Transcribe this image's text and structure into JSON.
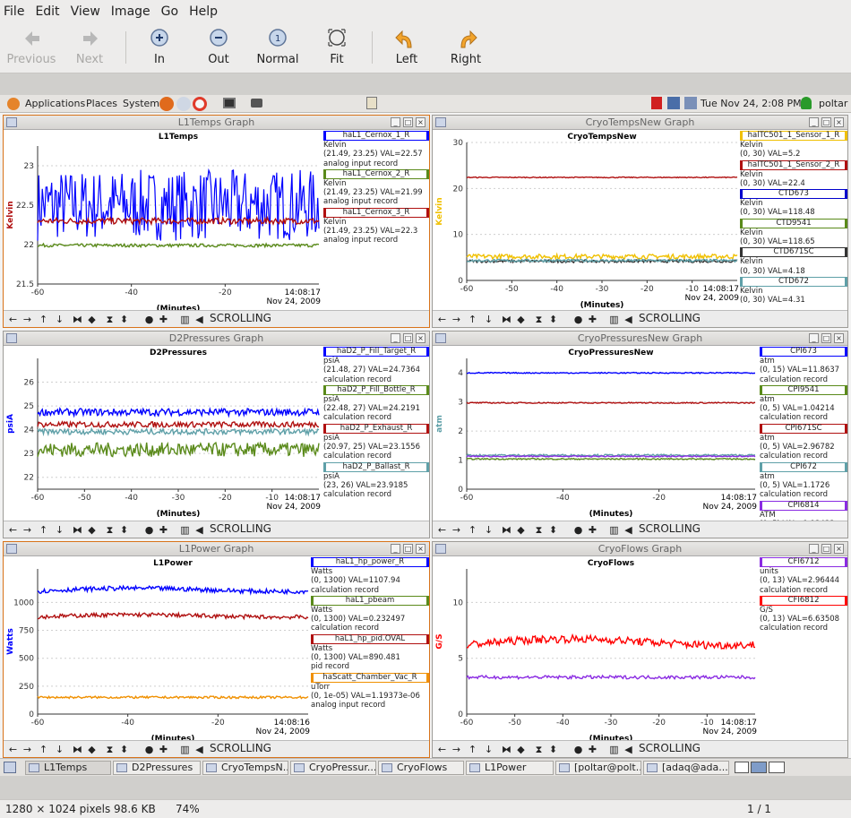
{
  "menubar": {
    "file": "File",
    "edit": "Edit",
    "view": "View",
    "image": "Image",
    "go": "Go",
    "help": "Help"
  },
  "toolbar": {
    "previous": "Previous",
    "next": "Next",
    "zoom_in": "In",
    "zoom_out": "Out",
    "normal": "Normal",
    "fit": "Fit",
    "rotate_left": "Left",
    "rotate_right": "Right"
  },
  "panel": {
    "applications": "Applications",
    "places": "Places",
    "system": "System",
    "clock": "Tue Nov 24,  2:08 PM",
    "user": "poltar"
  },
  "graphs": {
    "g1": {
      "window_title": "L1Temps Graph",
      "plot_title": "L1Temps",
      "ylabel": "Kelvin",
      "xlabel": "(Minutes)",
      "time": "14:08:17",
      "date": "Nov 24, 2009",
      "yticks": [
        "23",
        "22.5",
        "22",
        "21.5"
      ],
      "xticks": [
        "-60",
        "-40",
        "-20"
      ],
      "scroll": "SCROLLING",
      "legend": [
        {
          "name": "haL1_Cernox_1_R",
          "l1": "Kelvin",
          "l2": "(21.49, 23.25) VAL=22.57",
          "l3": "analog input record"
        },
        {
          "name": "haL1_Cernox_2_R",
          "l1": "Kelvin",
          "l2": "(21.49, 23.25) VAL=21.99",
          "l3": "analog input record"
        },
        {
          "name": "haL1_Cernox_3_R",
          "l1": "Kelvin",
          "l2": "(21.49, 23.25) VAL=22.3",
          "l3": "analog input record"
        }
      ]
    },
    "g2": {
      "window_title": "CryoTempsNew Graph",
      "plot_title": "CryoTempsNew",
      "ylabel": "Kelvin",
      "xlabel": "(Minutes)",
      "time": "14:08:17",
      "date": "Nov 24, 2009",
      "yticks": [
        "30",
        "20",
        "10",
        "0"
      ],
      "xticks": [
        "-60",
        "-50",
        "-40",
        "-30",
        "-20",
        "-10"
      ],
      "scroll": "SCROLLING",
      "legend": [
        {
          "name": "halTC501_1_Sensor_1_R",
          "l1": "Kelvin",
          "l2": "(0, 30) VAL=5.2",
          "l3": ""
        },
        {
          "name": "halTC501_1_Sensor_2_R",
          "l1": "Kelvin",
          "l2": "(0, 30) VAL=22.4",
          "l3": ""
        },
        {
          "name": "CTD673",
          "l1": "Kelvin",
          "l2": "(0, 30) VAL=118.48",
          "l3": ""
        },
        {
          "name": "CTD9541",
          "l1": "Kelvin",
          "l2": "(0, 30) VAL=118.65",
          "l3": ""
        },
        {
          "name": "CTD671SC",
          "l1": "Kelvin",
          "l2": "(0, 30) VAL=4.18",
          "l3": ""
        },
        {
          "name": "CTD672",
          "l1": "Kelvin",
          "l2": "(0, 30) VAL=4.31",
          "l3": ""
        }
      ]
    },
    "g3": {
      "window_title": "D2Pressures Graph",
      "plot_title": "D2Pressures",
      "ylabel": "psiA",
      "xlabel": "(Minutes)",
      "time": "14:08:17",
      "date": "Nov 24, 2009",
      "yticks": [
        "26",
        "25",
        "24",
        "23",
        "22"
      ],
      "xticks": [
        "-60",
        "-50",
        "-40",
        "-30",
        "-20",
        "-10"
      ],
      "scroll": "SCROLLING",
      "legend": [
        {
          "name": "haD2_P_Fill_Target_R",
          "l1": "psiA",
          "l2": "(21.48, 27) VAL=24.7364",
          "l3": "calculation record"
        },
        {
          "name": "haD2_P_Fill_Bottle_R",
          "l1": "psiA",
          "l2": "(22.48, 27) VAL=24.2191",
          "l3": "calculation record"
        },
        {
          "name": "haD2_P_Exhaust_R",
          "l1": "psiA",
          "l2": "(20.97, 25) VAL=23.1556",
          "l3": "calculation record"
        },
        {
          "name": "haD2_P_Ballast_R",
          "l1": "psiA",
          "l2": "(23, 26) VAL=23.9185",
          "l3": "calculation record"
        }
      ]
    },
    "g4": {
      "window_title": "CryoPressuresNew Graph",
      "plot_title": "CryoPressuresNew",
      "ylabel": "atm",
      "xlabel": "(Minutes)",
      "time": "14:08:17",
      "date": "Nov 24, 2009",
      "yticks": [
        "4",
        "3",
        "2",
        "1",
        "0"
      ],
      "xticks": [
        "-60",
        "-40",
        "-20"
      ],
      "scroll": "SCROLLING",
      "legend": [
        {
          "name": "CPI673",
          "l1": "atm",
          "l2": "(0, 15) VAL=11.8637",
          "l3": "calculation record"
        },
        {
          "name": "CPI9541",
          "l1": "atm",
          "l2": "(0, 5) VAL=1.04214",
          "l3": "calculation record"
        },
        {
          "name": "CPI671SC",
          "l1": "atm",
          "l2": "(0, 5) VAL=2.96782",
          "l3": "calculation record"
        },
        {
          "name": "CPI672",
          "l1": "atm",
          "l2": "(0, 5) VAL=1.1726",
          "l3": "calculation record"
        },
        {
          "name": "CPI6814",
          "l1": "ATM",
          "l2": "(0, 5) VAL=1.13433",
          "l3": "analog input record"
        }
      ]
    },
    "g5": {
      "window_title": "L1Power Graph",
      "plot_title": "L1Power",
      "ylabel": "Watts",
      "xlabel": "(Minutes)",
      "time": "14:08:16",
      "date": "Nov 24, 2009",
      "yticks": [
        "1000",
        "750",
        "500",
        "250",
        "0"
      ],
      "xticks": [
        "-60",
        "-40",
        "-20"
      ],
      "scroll": "SCROLLING",
      "legend": [
        {
          "name": "haL1_hp_power_R",
          "l1": "Watts",
          "l2": "(0, 1300) VAL=1107.94",
          "l3": "calculation record"
        },
        {
          "name": "haL1_pbeam",
          "l1": "Watts",
          "l2": "(0, 1300) VAL=0.232497",
          "l3": "calculation record"
        },
        {
          "name": "haL1_hp_pid.OVAL",
          "l1": "Watts",
          "l2": "(0, 1300) VAL=890.481",
          "l3": "pid record"
        },
        {
          "name": "haScatt_Chamber_Vac_R",
          "l1": "uTorr",
          "l2": "(0, 1e-05) VAL=1.19373e-06",
          "l3": "analog input record"
        }
      ]
    },
    "g6": {
      "window_title": "CryoFlows Graph",
      "plot_title": "CryoFlows",
      "ylabel": "G/S",
      "xlabel": "(Minutes)",
      "time": "14:08:17",
      "date": "Nov 24, 2009",
      "yticks": [
        "10",
        "5",
        "0"
      ],
      "xticks": [
        "-60",
        "-50",
        "-40",
        "-30",
        "-20",
        "-10"
      ],
      "scroll": "SCROLLING",
      "legend": [
        {
          "name": "CFI6712",
          "l1": "units",
          "l2": "(0, 13) VAL=2.96444",
          "l3": "calculation record"
        },
        {
          "name": "CFI6812",
          "l1": "G/S",
          "l2": "(0, 13) VAL=6.63508",
          "l3": "calculation record"
        }
      ]
    }
  },
  "colors": {
    "g1": [
      "#0000ff",
      "#5a8a1a",
      "#b01010"
    ],
    "g2": [
      "#f0c000",
      "#b01010",
      "#0000cc",
      "#5a8a1a",
      "#333333",
      "#5fa0a8"
    ],
    "g3": [
      "#0000ff",
      "#5a8a1a",
      "#b01010",
      "#5fa0a8"
    ],
    "g4": [
      "#0000ff",
      "#5a8a1a",
      "#b01010",
      "#5fa0a8",
      "#8a2be2"
    ],
    "g5": [
      "#0000ff",
      "#5a8a1a",
      "#b01010",
      "#f09000"
    ],
    "g6": [
      "#8a2be2",
      "#ff0000"
    ]
  },
  "taskbar": [
    "L1Temps",
    "D2Pressures",
    "CryoTempsN...",
    "CryoPressur...",
    "CryoFlows",
    "L1Power",
    "[poltar@polt...",
    "[adaq@ada..."
  ],
  "status": {
    "info": "1280 × 1024 pixels  98.6 KB",
    "zoom": "74%",
    "page": "1 / 1"
  },
  "chart_data": [
    {
      "type": "line",
      "title": "L1Temps",
      "xlabel": "(Minutes)",
      "ylabel": "Kelvin",
      "xlim": [
        -60,
        0
      ],
      "ylim": [
        21.5,
        23.25
      ],
      "series": [
        {
          "name": "haL1_Cernox_1_R",
          "values_mean": 22.5
        },
        {
          "name": "haL1_Cernox_2_R",
          "values_mean": 21.99
        },
        {
          "name": "haL1_Cernox_3_R",
          "values_mean": 22.3
        }
      ]
    },
    {
      "type": "line",
      "title": "CryoTempsNew",
      "xlabel": "(Minutes)",
      "ylabel": "Kelvin",
      "xlim": [
        -60,
        0
      ],
      "ylim": [
        0,
        30
      ],
      "series": [
        {
          "name": "halTC501_1_Sensor_1_R",
          "values_mean": 5.2
        },
        {
          "name": "halTC501_1_Sensor_2_R",
          "values_mean": 22.4
        },
        {
          "name": "CTD671SC",
          "values_mean": 4.18
        },
        {
          "name": "CTD672",
          "values_mean": 4.31
        }
      ]
    },
    {
      "type": "line",
      "title": "D2Pressures",
      "xlabel": "(Minutes)",
      "ylabel": "psiA",
      "xlim": [
        -60,
        0
      ],
      "ylim": [
        21.5,
        27
      ],
      "series": [
        {
          "name": "haD2_P_Fill_Target_R",
          "values_mean": 24.74
        },
        {
          "name": "haD2_P_Fill_Bottle_R",
          "values_mean": 24.22
        },
        {
          "name": "haD2_P_Exhaust_R",
          "values_mean": 23.16
        },
        {
          "name": "haD2_P_Ballast_R",
          "values_mean": 23.92
        }
      ]
    },
    {
      "type": "line",
      "title": "CryoPressuresNew",
      "xlabel": "(Minutes)",
      "ylabel": "atm",
      "xlim": [
        -60,
        0
      ],
      "ylim": [
        0,
        4.5
      ],
      "series": [
        {
          "name": "CPI9541",
          "values_mean": 1.04
        },
        {
          "name": "CPI671SC",
          "values_mean": 2.97
        },
        {
          "name": "CPI672",
          "values_mean": 1.17
        },
        {
          "name": "CPI6814",
          "values_mean": 1.13
        },
        {
          "name": "CPI673",
          "values_mean": 4.0
        }
      ]
    },
    {
      "type": "line",
      "title": "L1Power",
      "xlabel": "(Minutes)",
      "ylabel": "Watts",
      "xlim": [
        -60,
        0
      ],
      "ylim": [
        0,
        1300
      ],
      "series": [
        {
          "name": "haL1_hp_power_R",
          "values_mean": 1100
        },
        {
          "name": "haL1_hp_pid.OVAL",
          "values_mean": 870
        },
        {
          "name": "haScatt_Chamber_Vac_R",
          "values_mean": 150
        }
      ]
    },
    {
      "type": "line",
      "title": "CryoFlows",
      "xlabel": "(Minutes)",
      "ylabel": "G/S",
      "xlim": [
        -60,
        0
      ],
      "ylim": [
        0,
        13
      ],
      "series": [
        {
          "name": "CFI6812",
          "values_mean": 6.2
        },
        {
          "name": "CFI6712",
          "values_mean": 3.3
        }
      ]
    }
  ]
}
